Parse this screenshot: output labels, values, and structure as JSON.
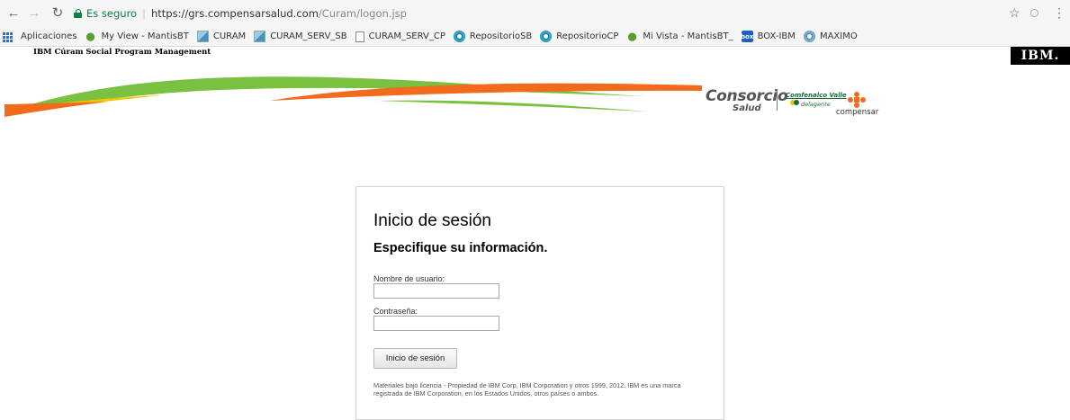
{
  "browser": {
    "security_label": "Es seguro",
    "url_origin": "https://grs.compensarsalud.com",
    "url_path": "/Curam/logon.jsp",
    "bookmarks": [
      {
        "label": "Aplicaciones",
        "icon": "apps-grid-icon"
      },
      {
        "label": "My View - MantisBT",
        "icon": "mantis-bug-icon"
      },
      {
        "label": "CURAM",
        "icon": "image-icon"
      },
      {
        "label": "CURAM_SERV_SB",
        "icon": "image-icon"
      },
      {
        "label": "CURAM_SERV_CP",
        "icon": "document-icon"
      },
      {
        "label": "RepositorioSB",
        "icon": "ring-icon"
      },
      {
        "label": "RepositorioCP",
        "icon": "ring-icon"
      },
      {
        "label": "Mi Vista - MantisBT_",
        "icon": "mantis-bug-icon"
      },
      {
        "label": "BOX-IBM",
        "icon": "box-icon"
      },
      {
        "label": "MAXIMO",
        "icon": "ring-icon"
      }
    ]
  },
  "header": {
    "product_name": "IBM Cúram Social Program Management",
    "ibm_logo": "IBM."
  },
  "branding": {
    "consorcio": "Consorcio",
    "salud": "Salud",
    "comfenalco": "Comfenalco Valle",
    "sub_brand": "delagente",
    "compensar": "compensar",
    "colors": {
      "orange": "#f26a1b",
      "green": "#7ac142",
      "yellow": "#f5c400"
    }
  },
  "login": {
    "title": "Inicio de sesión",
    "subtitle": "Especifique su información.",
    "username_label": "Nombre de usuario:",
    "username_value": "",
    "password_label": "Contraseña:",
    "password_value": "",
    "submit_label": "Inicio de sesión",
    "legal_text": "Materiales bajo licencia - Propiedad de IBM Corp, IBM Corporation y otros 1999, 2012. IBM es una marca registrada de IBM Corporation, en los Estados Unidos, otros países o ambos."
  }
}
